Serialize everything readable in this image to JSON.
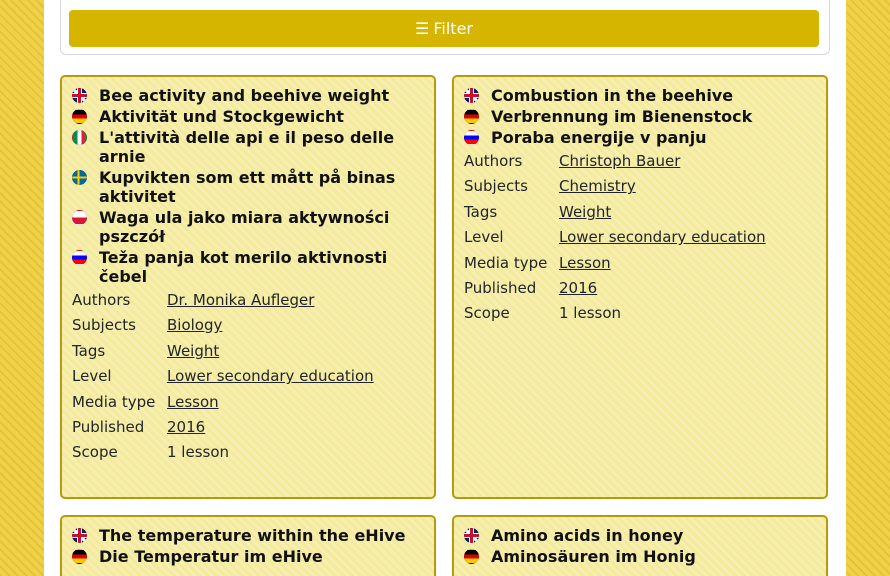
{
  "filter": {
    "icon": "☰",
    "label": "Filter"
  },
  "cards": [
    {
      "titles": [
        {
          "flag": "gb",
          "text": "Bee activity and beehive weight"
        },
        {
          "flag": "de",
          "text": "Aktivität und Stockgewicht"
        },
        {
          "flag": "it",
          "text": "L'attività delle api e il peso delle arnie"
        },
        {
          "flag": "se",
          "text": "Kupvikten som ett mått på binas aktivitet"
        },
        {
          "flag": "pl",
          "text": "Waga ula jako miara aktywności pszczół"
        },
        {
          "flag": "si",
          "text": "Teža panja kot merilo aktivnosti čebel"
        }
      ],
      "meta": [
        {
          "label": "Authors",
          "value": "Dr. Monika Aufleger",
          "link": true
        },
        {
          "label": "Subjects",
          "value": "Biology",
          "link": true
        },
        {
          "label": "Tags",
          "value": "Weight",
          "link": true
        },
        {
          "label": "Level",
          "value": "Lower secondary education",
          "link": true
        },
        {
          "label": "Media type",
          "value": "Lesson",
          "link": true
        },
        {
          "label": "Published",
          "value": "2016",
          "link": true
        },
        {
          "label": "Scope",
          "value": "1 lesson",
          "link": false
        }
      ]
    },
    {
      "titles": [
        {
          "flag": "gb",
          "text": "Combustion in the beehive"
        },
        {
          "flag": "de",
          "text": "Verbrennung im Bienenstock"
        },
        {
          "flag": "si",
          "text": "Poraba energije v panju"
        }
      ],
      "meta": [
        {
          "label": "Authors",
          "value": "Christoph Bauer",
          "link": true
        },
        {
          "label": "Subjects",
          "value": "Chemistry",
          "link": true
        },
        {
          "label": "Tags",
          "value": "Weight",
          "link": true
        },
        {
          "label": "Level",
          "value": "Lower secondary education",
          "link": true
        },
        {
          "label": "Media type",
          "value": "Lesson",
          "link": true
        },
        {
          "label": "Published",
          "value": "2016",
          "link": true
        },
        {
          "label": "Scope",
          "value": "1 lesson",
          "link": false
        }
      ]
    },
    {
      "titles": [
        {
          "flag": "gb",
          "text": "The temperature within the eHive"
        },
        {
          "flag": "de",
          "text": "Die Temperatur im eHive"
        }
      ],
      "meta": []
    },
    {
      "titles": [
        {
          "flag": "gb",
          "text": "Amino acids in honey"
        },
        {
          "flag": "de",
          "text": "Aminosäuren im Honig"
        }
      ],
      "meta": []
    }
  ]
}
